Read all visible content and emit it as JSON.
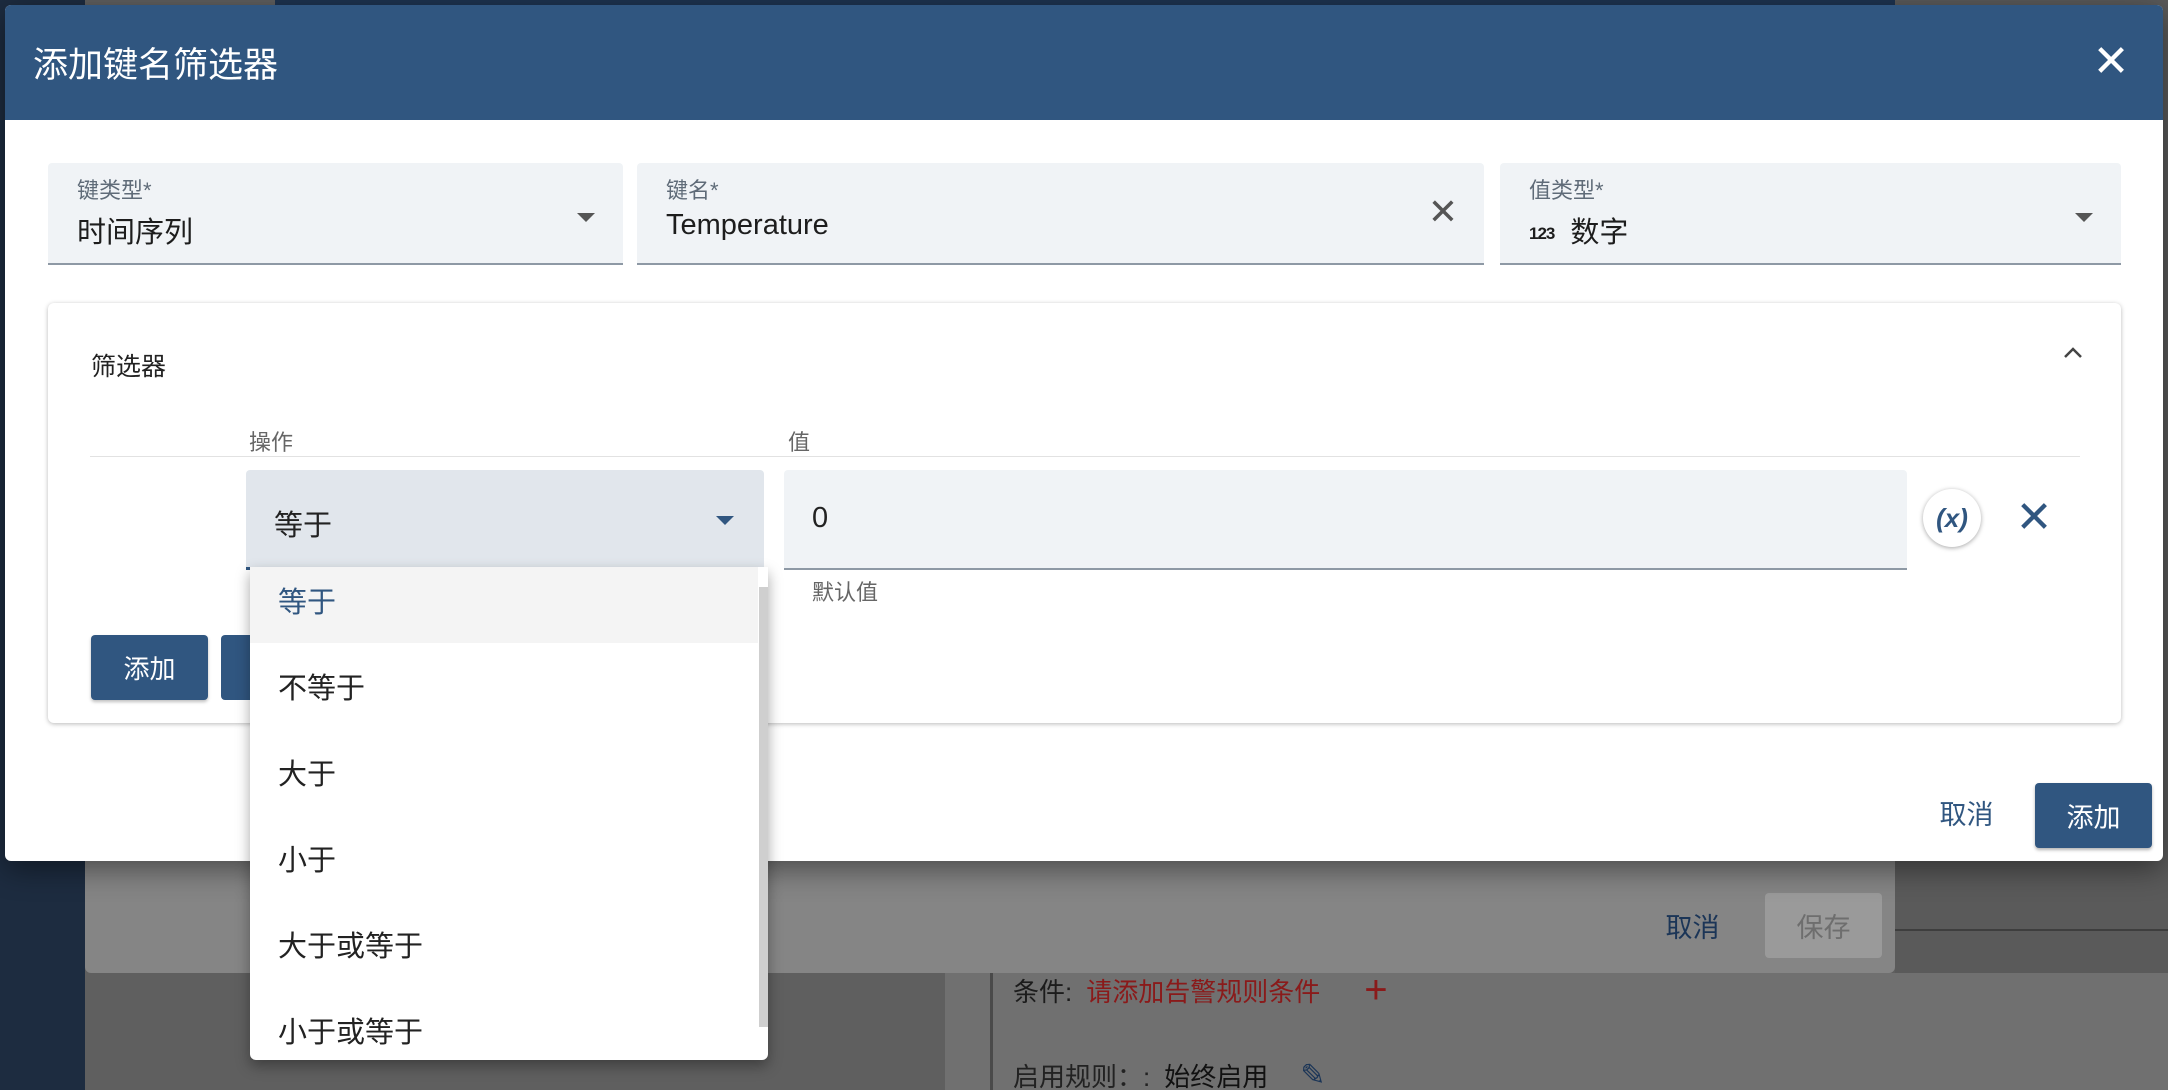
{
  "background": {
    "cancel_label": "取消",
    "save_label": "保存",
    "condition_label": "条件:",
    "condition_error": "请添加告警规则条件",
    "enable_label": "启用规则：:",
    "enable_value": "始终启用"
  },
  "dialog": {
    "title": "添加键名筛选器",
    "key_type": {
      "label": "键类型*",
      "value": "时间序列"
    },
    "key_name": {
      "label": "键名*",
      "value": "Temperature"
    },
    "value_type": {
      "label": "值类型*",
      "badge": "123",
      "value": "数字"
    },
    "filters": {
      "title": "筛选器",
      "operation_header": "操作",
      "value_header": "值",
      "operation_value": "等于",
      "value": "0",
      "value_hint": "默认值",
      "var_button": "(x)",
      "add_label": "添加"
    },
    "cancel_label": "取消",
    "submit_label": "添加"
  },
  "operation_menu": {
    "options": [
      "等于",
      "不等于",
      "大于",
      "小于",
      "大于或等于",
      "小于或等于"
    ],
    "selected_index": 0
  },
  "colors": {
    "primary": "#305680",
    "error": "#8a1a1a"
  }
}
